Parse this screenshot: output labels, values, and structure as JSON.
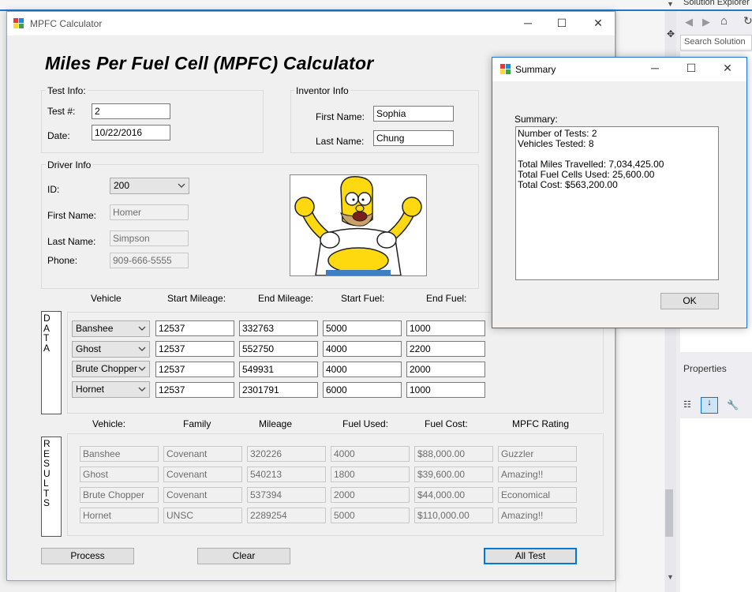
{
  "ide": {
    "solution_explorer_title": "Solution Explorer",
    "search_placeholder": "Search Solution",
    "properties_title": "Properties"
  },
  "window": {
    "title": "MPFC Calculator",
    "heading": "Miles Per Fuel Cell (MPFC) Calculator"
  },
  "test_info": {
    "group_label": "Test Info:",
    "test_label": "Test #:",
    "test_value": "2",
    "date_label": "Date:",
    "date_value": "10/22/2016"
  },
  "inventor_info": {
    "group_label": "Inventor Info",
    "first_label": "First Name:",
    "first_value": "Sophia",
    "last_label": "Last Name:",
    "last_value": "Chung"
  },
  "driver_info": {
    "group_label": "Driver Info",
    "id_label": "ID:",
    "id_value": "200",
    "first_label": "First Name:",
    "first_value": "Homer",
    "last_label": "Last Name:",
    "last_value": "Simpson",
    "phone_label": "Phone:",
    "phone_value": "909-666-5555"
  },
  "data_section": {
    "side_label": [
      "D",
      "A",
      "T",
      "A"
    ],
    "headers": [
      "Vehicle",
      "Start Mileage:",
      "End Mileage:",
      "Start Fuel:",
      "End Fuel:"
    ],
    "rows": [
      {
        "vehicle": "Banshee",
        "start_mileage": "12537",
        "end_mileage": "332763",
        "start_fuel": "5000",
        "end_fuel": "1000"
      },
      {
        "vehicle": "Ghost",
        "start_mileage": "12537",
        "end_mileage": "552750",
        "start_fuel": "4000",
        "end_fuel": "2200"
      },
      {
        "vehicle": "Brute Chopper",
        "start_mileage": "12537",
        "end_mileage": "549931",
        "start_fuel": "4000",
        "end_fuel": "2000"
      },
      {
        "vehicle": "Hornet",
        "start_mileage": "12537",
        "end_mileage": "2301791",
        "start_fuel": "6000",
        "end_fuel": "1000"
      }
    ]
  },
  "results_section": {
    "side_label": [
      "R",
      "E",
      "S",
      "U",
      "L",
      "T",
      "S"
    ],
    "headers": [
      "Vehicle:",
      "Family",
      "Mileage",
      "Fuel Used:",
      "Fuel Cost:",
      "MPFC Rating"
    ],
    "rows": [
      {
        "vehicle": "Banshee",
        "family": "Covenant",
        "mileage": "320226",
        "fuel_used": "4000",
        "fuel_cost": "$88,000.00",
        "rating": "Guzzler"
      },
      {
        "vehicle": "Ghost",
        "family": "Covenant",
        "mileage": "540213",
        "fuel_used": "1800",
        "fuel_cost": "$39,600.00",
        "rating": "Amazing!!"
      },
      {
        "vehicle": "Brute Chopper",
        "family": "Covenant",
        "mileage": "537394",
        "fuel_used": "2000",
        "fuel_cost": "$44,000.00",
        "rating": "Economical"
      },
      {
        "vehicle": "Hornet",
        "family": "UNSC",
        "mileage": "2289254",
        "fuel_used": "5000",
        "fuel_cost": "$110,000.00",
        "rating": "Amazing!!"
      }
    ]
  },
  "buttons": {
    "process": "Process",
    "clear": "Clear",
    "all_test": "All Test"
  },
  "summary_dialog": {
    "title": "Summary",
    "label": "Summary:",
    "text": "Number of Tests: 2\nVehicles Tested: 8\n\nTotal Miles Travelled: 7,034,425.00\nTotal Fuel Cells Used: 25,600.00\nTotal Cost: $563,200.00",
    "ok": "OK"
  },
  "colors": {
    "accent": "#0078d7",
    "window_bg": "#f0f0f0"
  }
}
